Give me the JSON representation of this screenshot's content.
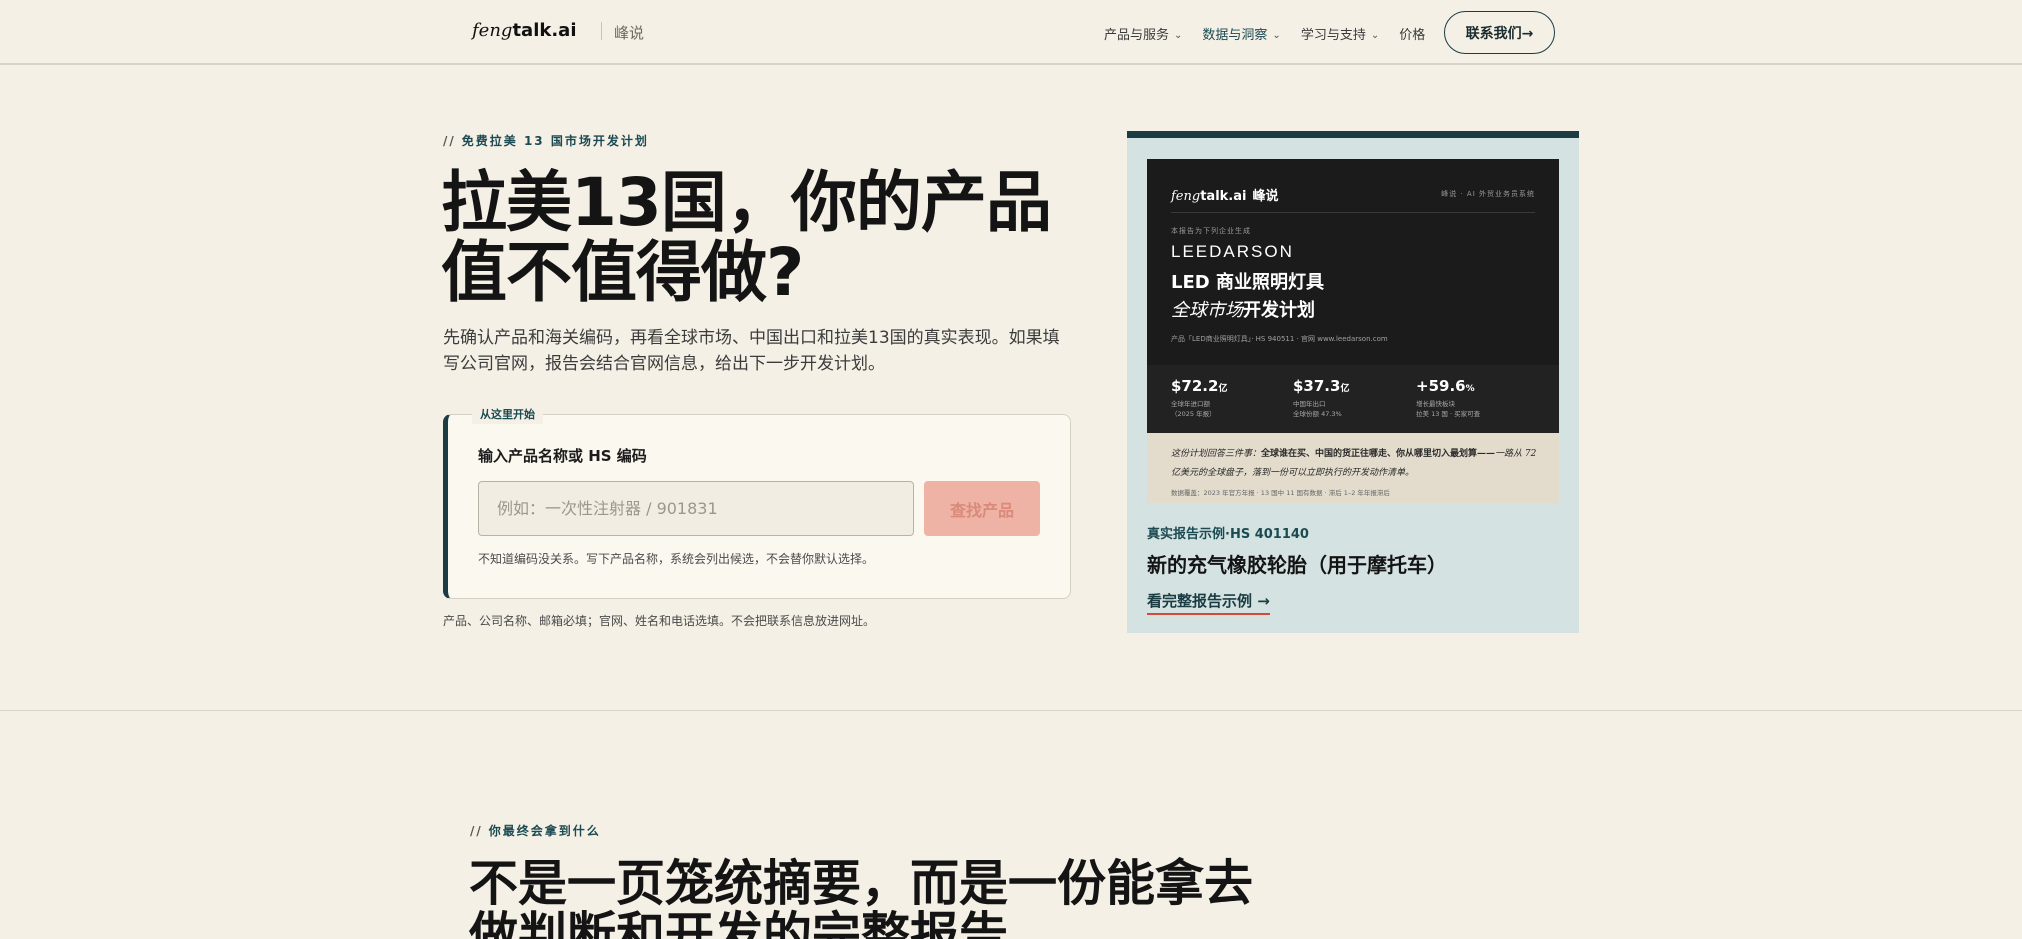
{
  "nav": {
    "logo_italic": "feng",
    "logo_bold": "talk.ai",
    "brand_sub": "峰说",
    "items": [
      {
        "label": "产品与服务",
        "has_menu": true
      },
      {
        "label": "数据与洞察",
        "has_menu": true
      },
      {
        "label": "学习与支持",
        "has_menu": true
      },
      {
        "label": "价格",
        "has_menu": false
      }
    ],
    "contact_label": "联系我们→"
  },
  "hero": {
    "eyebrow_slashes": "//",
    "eyebrow": "免费拉美 13 国市场开发计划",
    "title": "拉美13国，你的产品值不值得做?",
    "description": "先确认产品和海关编码，再看全球市场、中国出口和拉美13国的真实表现。如果填写公司官网，报告会结合官网信息，给出下一步开发计划。",
    "form": {
      "tag": "从这里开始",
      "label": "输入产品名称或 HS 编码",
      "input_value": "",
      "input_placeholder": "例如：一次性注射器 / 901831",
      "button_label": "查找产品",
      "hint": "不知道编码没关系。写下产品名称，系统会列出候选，不会替你默认选择。"
    },
    "legal_note": "产品、公司名称、邮箱必填；官网、姓名和电话选填。不会把联系信息放进网址。"
  },
  "preview": {
    "report": {
      "logo_italic": "feng",
      "logo_bold": "talk.ai",
      "logo_cn": "峰说",
      "tagline": "峰说 · AI 外贸业务员系统",
      "prepared_for": "本报告为下列企业生成",
      "company": "LEEDARSON",
      "title_line1": "LED 商业照明灯具",
      "title_line2_italic": "全球市场",
      "title_line2_bold": "开发计划",
      "meta": "产品「LED商业照明灯具」· HS 940511 · 官网 www.leedarson.com",
      "stats": [
        {
          "value": "$72.2",
          "unit": "亿",
          "label1": "全球年进口额",
          "label2": "（2025 年报）"
        },
        {
          "value": "$37.3",
          "unit": "亿",
          "label1": "中国年出口",
          "label2": "全球份额 47.3%"
        },
        {
          "value": "+59.6",
          "unit": "%",
          "label1": "增长最快板块",
          "label2": "拉美 13 国 · 买家可查"
        }
      ],
      "summary_italic1": "这份计划回答三件事：",
      "summary_bold": "全球谁在买、中国的货正往哪走、你从哪里切入最划算——",
      "summary_italic2": "一路从 72 亿美元的全球盘子，落到一份可以立即执行的开发动作清单。",
      "source": "数据覆盖：2023 年官方年报 · 13 国中 11 国有数据 · 滞后 1–2 年年报滞后"
    },
    "kicker": "真实报告示例·HS 401140",
    "title": "新的充气橡胶轮胎（用于摩托车）",
    "link_label": "看完整报告示例 →"
  },
  "section2": {
    "eyebrow_slashes": "//",
    "eyebrow": "你最终会拿到什么",
    "title": "不是一页笼统摘要，而是一份能拿去做判断和开发的完整报告"
  }
}
